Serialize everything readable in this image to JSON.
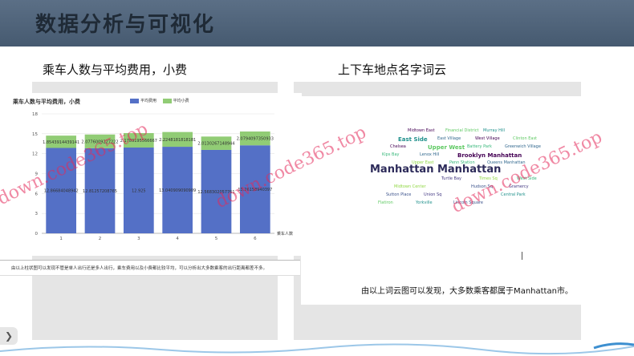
{
  "header": {
    "title": "数据分析与可视化"
  },
  "left_section": {
    "heading": "乘车人数与平均费用，小费",
    "note": "由以上柱状图可以发现不管是单人出行还是多人出行，乘车费用以及小费都比较平均，可以分析出大多数乘客的出行距离都差不多。"
  },
  "right_section": {
    "heading": "上下车地点名字词云",
    "caption": "由以上词云图可以发现，大多数乘客都属于Manhattan市。"
  },
  "wordcloud": {
    "words": [
      "Manhattan Manhattan",
      "East Side",
      "Upper West",
      "Brooklyn Manhattan",
      "Queens Manhattan",
      "West Side",
      "Midtown Center",
      "Union Sq",
      "Lincoln Square",
      "Murray Hill",
      "Clinton East",
      "Chelsea",
      "Lenox Hill",
      "Penn Station",
      "Times Sq",
      "Gramercy",
      "Sutton Place",
      "Yorkville",
      "Financial District",
      "West Village",
      "Greenwich Village",
      "Kips Bay",
      "Upper East",
      "Turtle Bay",
      "Hudson Sq",
      "Central Park",
      "Flatiron",
      "Midtown East",
      "East Village",
      "Battery Park"
    ]
  },
  "watermark": {
    "text": "down.code365.top"
  },
  "chart_data": {
    "type": "bar",
    "title": "乘车人数与平均费用，小费",
    "categories": [
      "1",
      "2",
      "3",
      "4",
      "5",
      "6"
    ],
    "xlabel": "乘车人数",
    "ylabel": "",
    "ylim": [
      0,
      18
    ],
    "yticks": [
      "0",
      "3",
      "6",
      "9",
      "12",
      "15",
      "18"
    ],
    "stacked": true,
    "legend_position": "top",
    "series": [
      {
        "name": "平均费用",
        "color": "#5470c6",
        "values": [
          12.86684048942,
          12.81257208765,
          12.925,
          13.04090909091,
          12.56830205776,
          13.26158940397
        ],
        "labels": [
          "12.86684048942",
          "12.81257208765",
          "12.925",
          "13.040909090909",
          "12.568302057761",
          "13.26158940397"
        ]
      },
      {
        "name": "平均小费",
        "color": "#91cc75",
        "values": [
          1.854391443914,
          2.07760092272,
          2.17891955666,
          2.22481818181,
          2.01302671489,
          2.07940973509
        ],
        "labels": [
          "1.8543914439141",
          "2.0776009227222",
          "2.1789195566667",
          "2.2248181818181",
          "2.0130267148944",
          "2.0794097350933"
        ]
      }
    ]
  }
}
